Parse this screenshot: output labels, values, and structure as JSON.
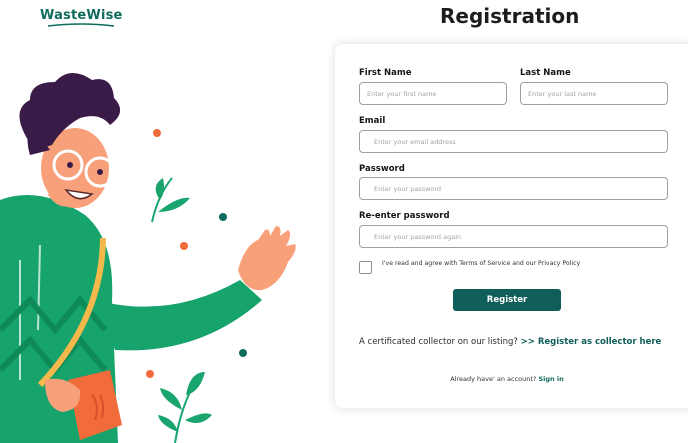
{
  "brand": {
    "logo_text": "WasteWise"
  },
  "page": {
    "title": "Registration"
  },
  "form": {
    "first_name": {
      "label": "First Name",
      "placeholder": "Enter your first name",
      "value": ""
    },
    "last_name": {
      "label": "Last Name",
      "placeholder": "Enter your last name",
      "value": ""
    },
    "email": {
      "label": "Email",
      "placeholder": "Enter your email address",
      "value": ""
    },
    "password": {
      "label": "Password",
      "placeholder": "Enter your password",
      "value": ""
    },
    "reenter_password": {
      "label": "Re-enter password",
      "placeholder": "Enter your password again",
      "value": ""
    },
    "terms": {
      "text": "I've read and agree with Terms of Service and our Privacy Policy",
      "checked": false
    },
    "register_button": "Register",
    "collector_prompt": "A certificated collector on our listing?",
    "collector_link": ">> Register as collector here",
    "signin_prompt": "Already have' an account?",
    "signin_link": "Sign in"
  },
  "colors": {
    "brand": "#0f6b5c",
    "button": "#0f5e59",
    "shirt": "#16a36c",
    "hair": "#3a1a47",
    "accent_orange": "#f26b3a"
  },
  "icons": {
    "illustration": "waving-person-illustration"
  }
}
